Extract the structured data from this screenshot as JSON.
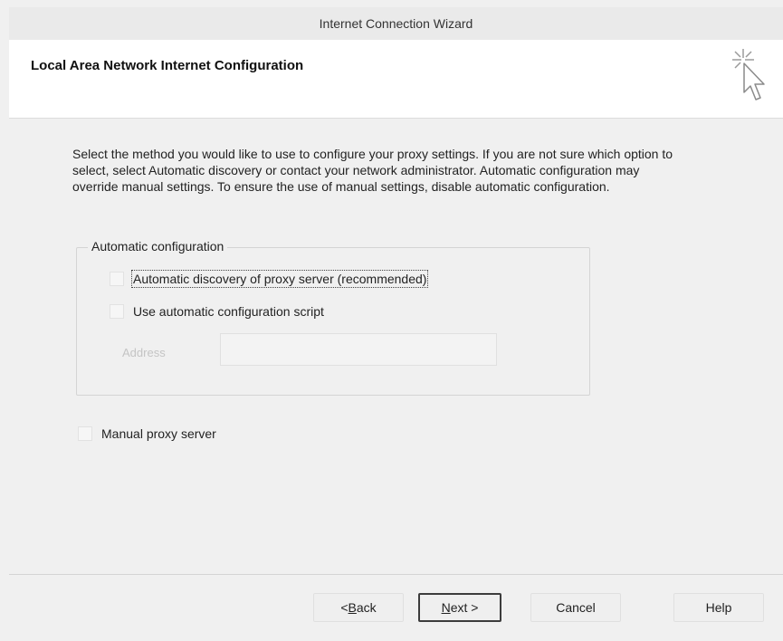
{
  "window": {
    "title": "Internet Connection Wizard"
  },
  "header": {
    "heading": "Local Area Network Internet Configuration",
    "icon": "wizard-cursor-icon"
  },
  "intro": {
    "text": "Select the method you would like to use to configure your proxy settings. If you are not sure which option to select, select Automatic discovery or contact your network administrator. Automatic configuration may override manual settings. To ensure the use of manual settings, disable automatic configuration."
  },
  "automatic_configuration": {
    "legend": "Automatic configuration",
    "auto_discovery": {
      "mnemonic": "A",
      "rest": "utomatic discovery of proxy server (recommended)",
      "checked": false
    },
    "auto_script": {
      "pre": "Use automatic configuration ",
      "mnemonic": "s",
      "post": "cript",
      "checked": false
    },
    "address": {
      "label": "Address",
      "value": ""
    }
  },
  "manual_proxy": {
    "mnemonic": "M",
    "rest": "anual proxy server",
    "checked": false
  },
  "buttons": {
    "back": {
      "pre": "< ",
      "mnemonic": "B",
      "post": "ack"
    },
    "next": {
      "mnemonic": "N",
      "post": "ext >"
    },
    "cancel": {
      "label": "Cancel"
    },
    "help": {
      "label": "Help"
    }
  }
}
